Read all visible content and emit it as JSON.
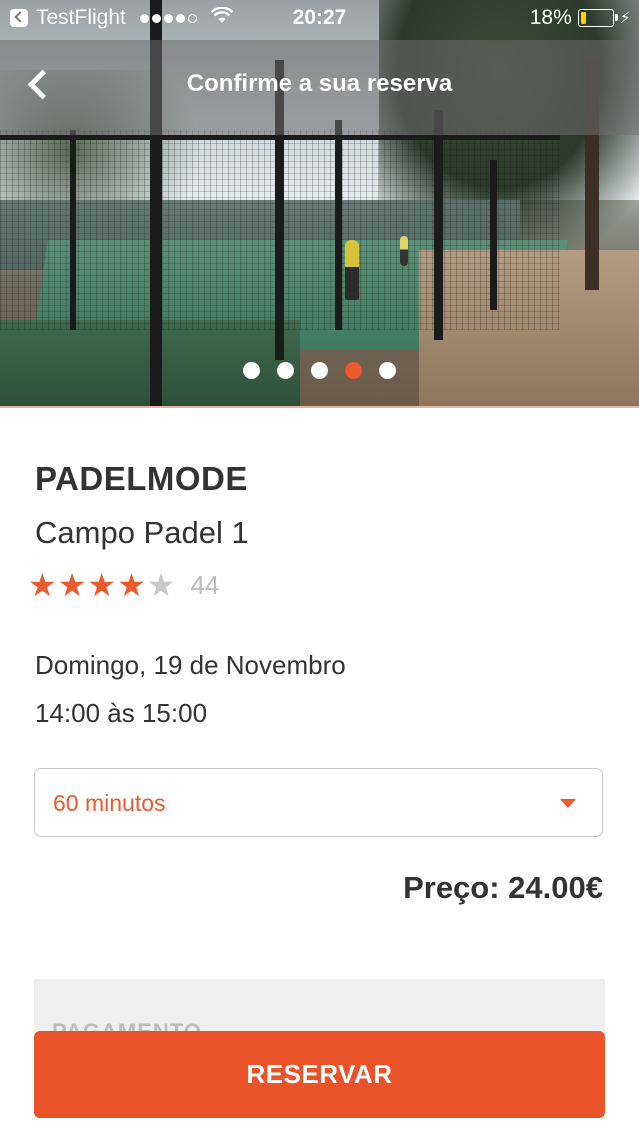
{
  "status_bar": {
    "app_back_label": "TestFlight",
    "signal_bars_filled": 4,
    "signal_bars_total": 5,
    "time": "20:27",
    "battery_text": "18%",
    "battery_level": 0.18
  },
  "nav": {
    "title": "Confirme a sua reserva"
  },
  "carousel": {
    "total": 5,
    "active_index": 3
  },
  "venue": {
    "club_name": "PADELMODE",
    "court_name": "Campo Padel 1",
    "rating_stars": 4,
    "rating_max": 5,
    "reviews_count": "44"
  },
  "booking": {
    "date": "Domingo, 19 de Novembro",
    "hours": "14:00 às 15:00",
    "duration_selected": "60 minutos",
    "price_text": "Preço: 24.00€"
  },
  "payment": {
    "section_label": "PAGAMENTO"
  },
  "actions": {
    "reserve_label": "RESERVAR"
  },
  "colors": {
    "accent": "#ea5329",
    "star_empty": "#c9c9c9"
  }
}
